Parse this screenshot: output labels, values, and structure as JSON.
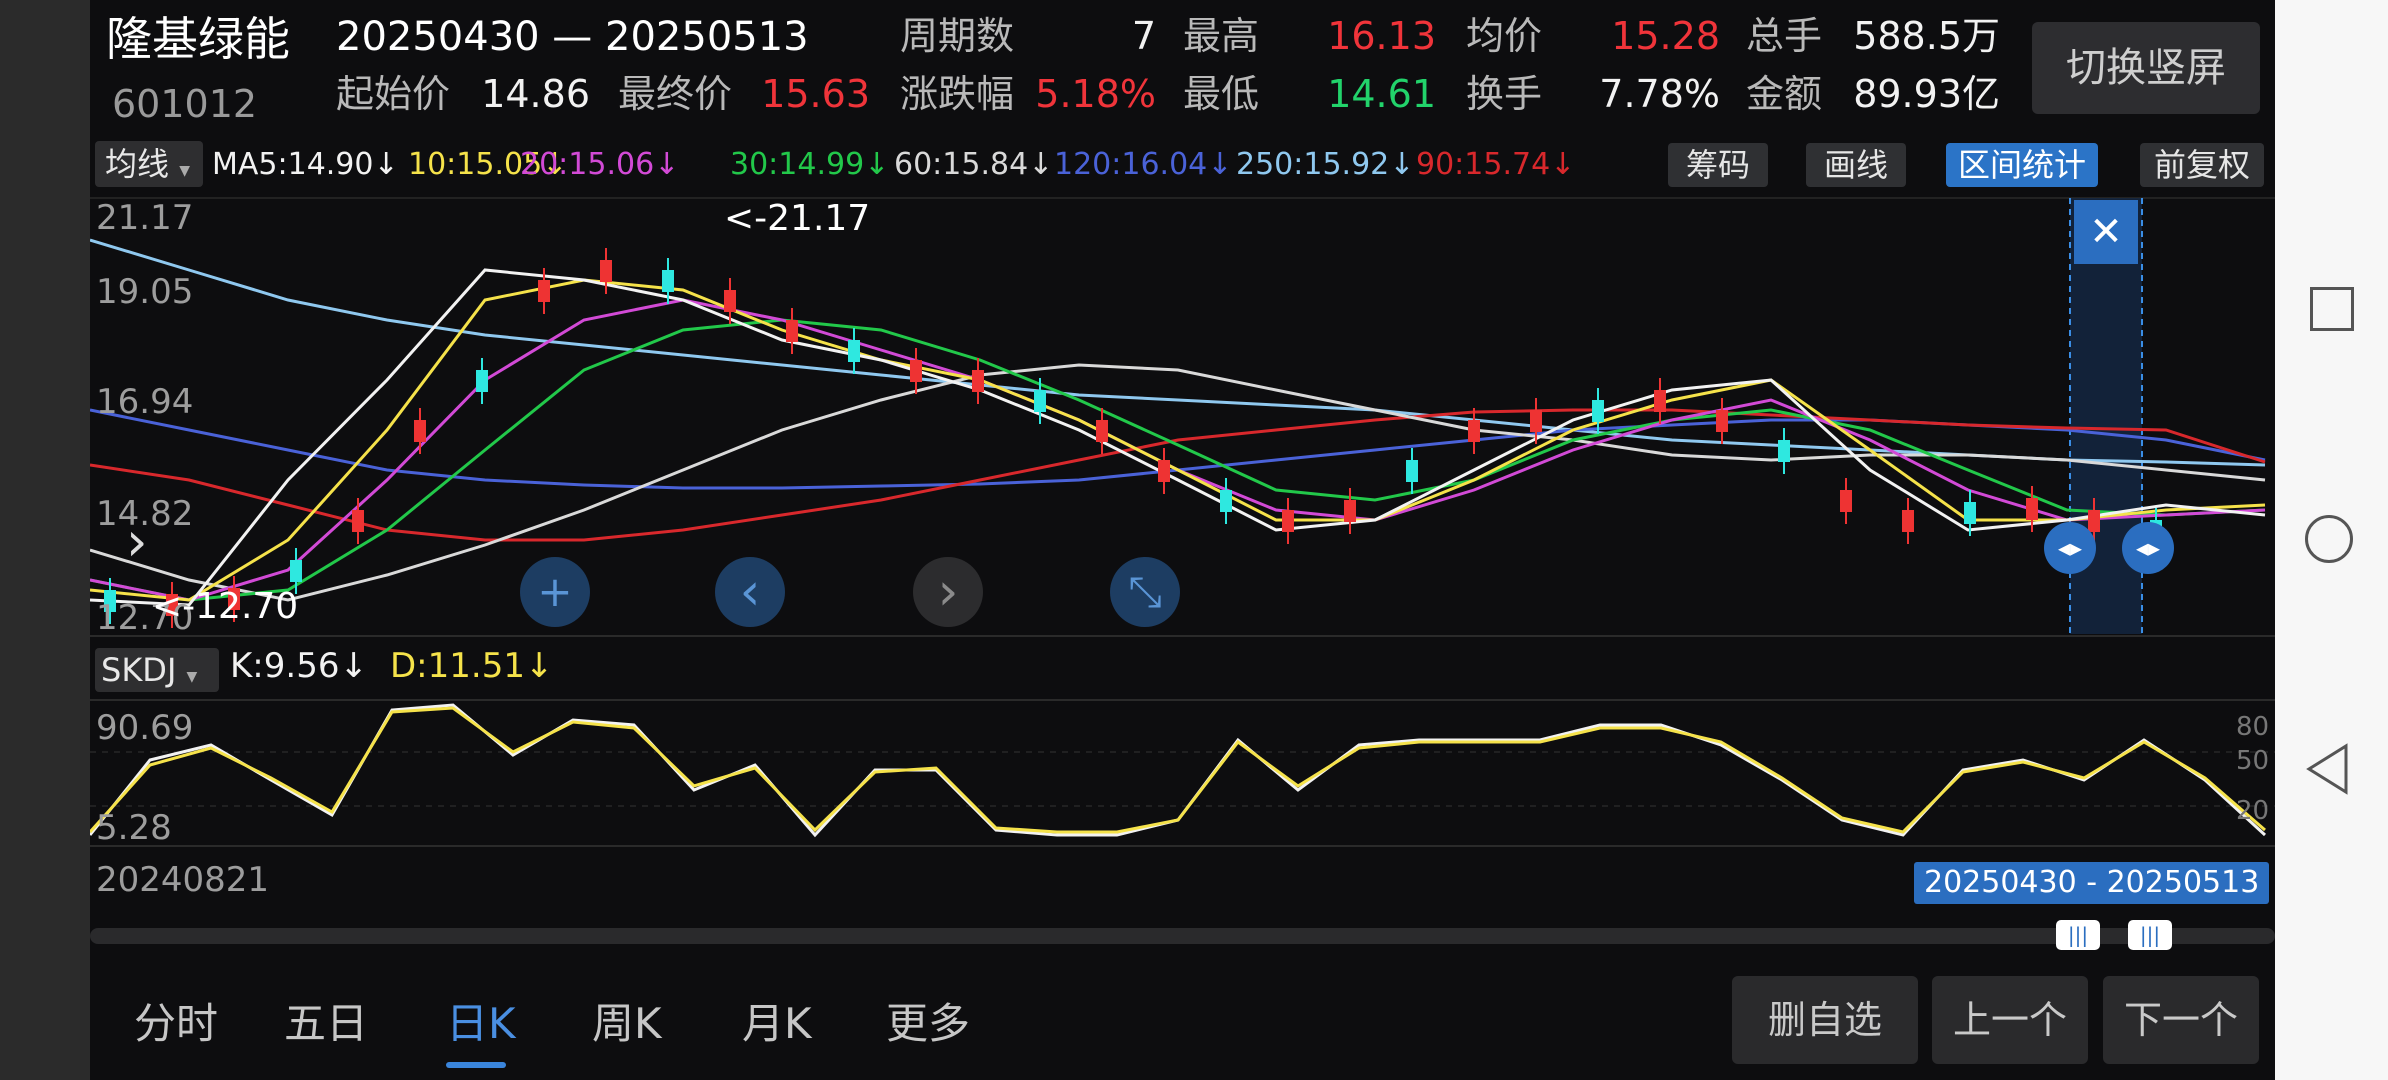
{
  "header": {
    "stock_name": "隆基绿能",
    "stock_code": "601012",
    "date_range": "20250430 — 20250513",
    "stats": [
      {
        "label": "周期数",
        "value": "7",
        "color": "white"
      },
      {
        "label": "最高",
        "value": "16.13",
        "color": "red"
      },
      {
        "label": "均价",
        "value": "15.28",
        "color": "red"
      },
      {
        "label": "总手",
        "value": "588.5万",
        "color": "white"
      },
      {
        "label": "起始价",
        "value": "14.86",
        "color": "white"
      },
      {
        "label": "最终价",
        "value": "15.63",
        "color": "red"
      },
      {
        "label": "涨跌幅",
        "value": "5.18%",
        "color": "red"
      },
      {
        "label": "最低",
        "value": "14.61",
        "color": "green"
      },
      {
        "label": "换手",
        "value": "7.78%",
        "color": "white"
      },
      {
        "label": "金额",
        "value": "89.93亿",
        "color": "white"
      }
    ],
    "switch_button": "切换竖屏"
  },
  "indicator_bar": {
    "dropdown": "均线",
    "ma_items": [
      {
        "text": "MA5:14.90↓",
        "color": "#f2f2f2"
      },
      {
        "text": "10:15.05↓",
        "color": "#f5e24a"
      },
      {
        "text": "20:15.06↓",
        "color": "#d24ad6"
      },
      {
        "text": "30:14.99↓",
        "color": "#22c84a"
      },
      {
        "text": "60:15.84↓",
        "color": "#d9d9d9"
      },
      {
        "text": "120:16.04↓",
        "color": "#4a62d8"
      },
      {
        "text": "250:15.92↓",
        "color": "#8fc8ef"
      },
      {
        "text": "90:15.74↓",
        "color": "#d8282c"
      }
    ],
    "tools": [
      "筹码",
      "画线",
      "区间统计",
      "前复权"
    ],
    "active_tool": "区间统计"
  },
  "main_chart": {
    "y_labels": [
      "21.17",
      "19.05",
      "16.94",
      "14.82",
      "12.70"
    ],
    "max_marker": "<-21.17",
    "min_marker": "<-12.70",
    "close_symbol": "✕"
  },
  "skdj": {
    "dropdown": "SKDJ",
    "k_text": "K:9.56↓",
    "d_text": "D:11.51↓",
    "y_labels": [
      "90.69",
      "5.28"
    ],
    "right_labels": [
      "80",
      "50",
      "20"
    ],
    "start_date": "20240821",
    "range_badge": "20250430 - 20250513"
  },
  "tabs": [
    "分时",
    "五日",
    "日K",
    "周K",
    "月K",
    "更多"
  ],
  "active_tab": "日K",
  "bottom_buttons": [
    "删自选",
    "上一个",
    "下一个"
  ],
  "icons": {
    "zoom_in": "+",
    "prev": "‹",
    "next": "›",
    "collapse": "⤡",
    "expand_left": "›"
  }
}
